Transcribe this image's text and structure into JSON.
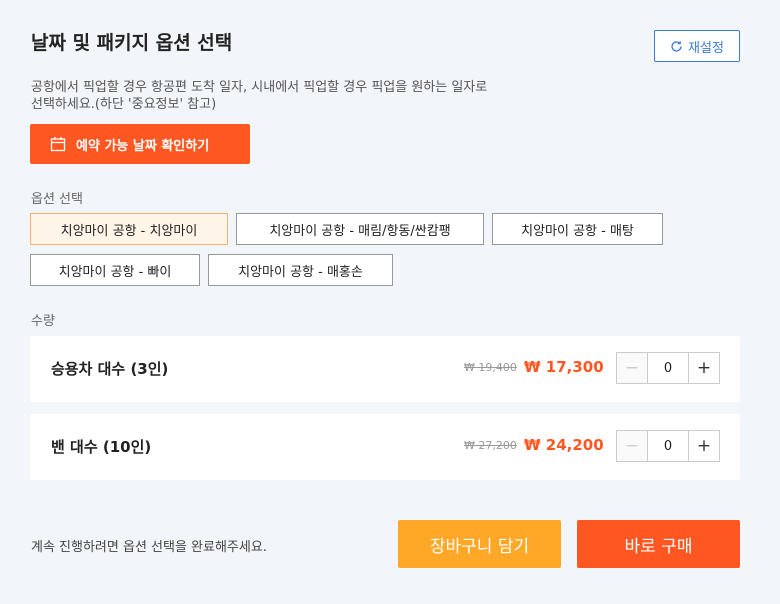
{
  "header": {
    "title": "날짜 및 패키지 옵션 선택",
    "reset_label": "재설정"
  },
  "description": "공항에서 픽업할 경우 항공편 도착 일자, 시내에서 픽업할 경우 픽업을 원하는 일자로 선택하세요.(하단 '중요정보' 참고)",
  "date_button_label": "예약 가능 날짜 확인하기",
  "options": {
    "label": "옵션 선택",
    "items": [
      "치앙마이 공항 - 치앙마이",
      "치앙마이 공항 - 매림/항동/싼캄팽",
      "치앙마이 공항 - 매탕",
      "치앙마이 공항 - 빠이",
      "치앙마이 공항 - 매홍손"
    ],
    "selected": "치앙마이 공항 - 치앙마이"
  },
  "quantity": {
    "label": "수량",
    "rows": [
      {
        "label": "승용차 대수 (3인)",
        "old_price": "₩ 19,400",
        "price": "₩ 17,300",
        "qty": "0"
      },
      {
        "label": "밴 대수 (10인)",
        "old_price": "₩ 27,200",
        "price": "₩ 24,200",
        "qty": "0"
      }
    ]
  },
  "footer": {
    "note": "계속 진행하려면 옵션 선택을 완료해주세요.",
    "cart_label": "장바구니 담기",
    "buy_label": "바로 구매"
  },
  "colors": {
    "accent": "#ff5722",
    "cart": "#ffa726",
    "link": "#3c7bd6"
  }
}
